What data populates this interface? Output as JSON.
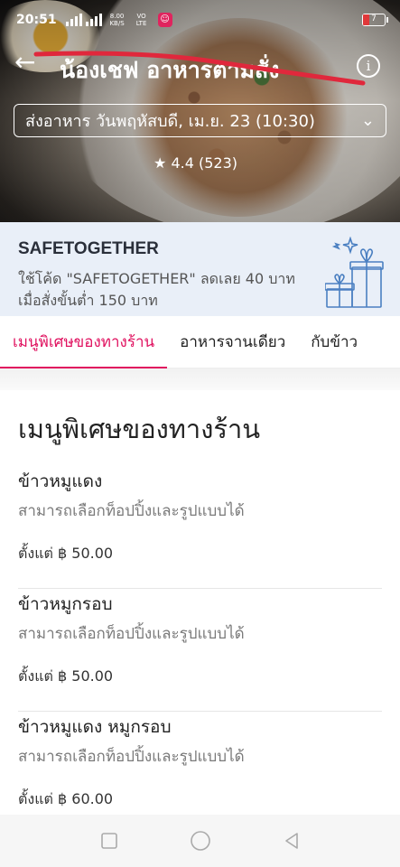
{
  "status_bar": {
    "time": "20:51",
    "network_speed": "8.00 KB/S",
    "carrier": "VO LTE",
    "battery_level": "7"
  },
  "header": {
    "shop_name": "น้องเชฟ อาหารตามสั่ง",
    "schedule": "ส่งอาหาร วันพฤหัสบดี, เม.ย. 23 (10:30)",
    "rating": "4.4 (523)"
  },
  "promo": {
    "code": "SAFETOGETHER",
    "description": "ใช้โค้ด \"SAFETOGETHER\" ลดเลย 40 บาท เมื่อสั่งขั้นต่ำ 150 บาท"
  },
  "tabs": [
    {
      "label": "เมนูพิเศษของทางร้าน",
      "active": true
    },
    {
      "label": "อาหารจานเดียว",
      "active": false
    },
    {
      "label": "กับข้าว",
      "active": false
    }
  ],
  "section": {
    "title": "เมนูพิเศษของทางร้าน",
    "items": [
      {
        "name": "ข้าวหมูแดง",
        "description": "สามารถเลือกท็อปปิ้งและรูปแบบได้",
        "price": "ตั้งแต่ ฿ 50.00"
      },
      {
        "name": "ข้าวหมูกรอบ",
        "description": "สามารถเลือกท็อปปิ้งและรูปแบบได้",
        "price": "ตั้งแต่ ฿ 50.00"
      },
      {
        "name": "ข้าวหมูแดง หมูกรอบ",
        "description": "สามารถเลือกท็อปปิ้งและรูปแบบได้",
        "price": "ตั้งแต่ ฿ 60.00"
      }
    ]
  },
  "colors": {
    "accent": "#e0115f",
    "promo_bg": "#e9eff8",
    "strike": "#e0283c"
  },
  "icons": [
    "back-arrow-icon",
    "info-icon",
    "chevron-down-icon",
    "star-icon",
    "gift-icon",
    "square-nav-icon",
    "circle-nav-icon",
    "triangle-back-nav-icon"
  ]
}
